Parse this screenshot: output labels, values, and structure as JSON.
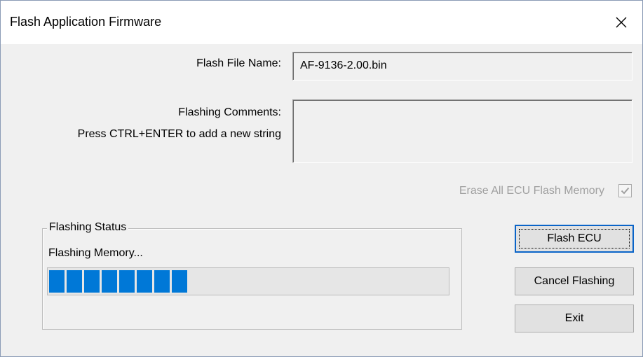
{
  "window": {
    "title": "Flash Application Firmware"
  },
  "form": {
    "file_name_label": "Flash File Name:",
    "file_name_value": "AF-9136-2.00.bin",
    "comments_label": "Flashing Comments:",
    "comments_hint": "Press CTRL+ENTER to add a new string",
    "comments_value": "",
    "erase_label": "Erase All ECU Flash Memory",
    "erase_checked": true,
    "erase_enabled": false
  },
  "status": {
    "group_title": "Flashing Status",
    "message": "Flashing Memory...",
    "progress_blocks_filled": 8,
    "progress_fraction": 0.36,
    "progress_color": "#0078d7"
  },
  "buttons": {
    "flash_label": "Flash ECU",
    "cancel_label": "Cancel Flashing",
    "exit_label": "Exit"
  },
  "icons": {
    "close": "close-icon",
    "check": "checkmark-icon"
  }
}
